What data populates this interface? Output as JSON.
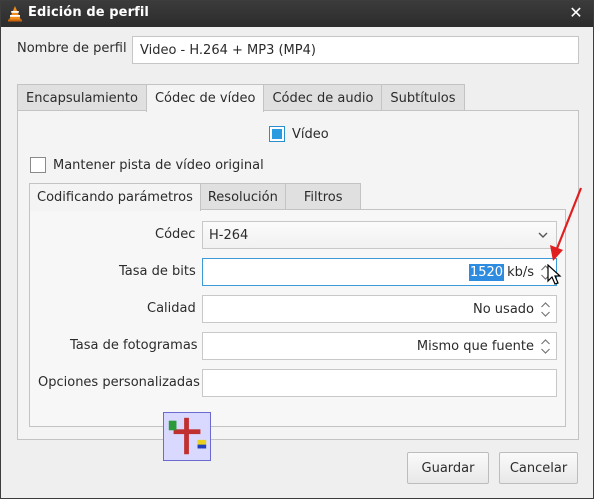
{
  "window": {
    "title": "Edición de perfil",
    "close_label": "✕"
  },
  "profile": {
    "label": "Nombre de perfil",
    "value": "Video - H.264 + MP3 (MP4)"
  },
  "tabs": [
    {
      "label": "Encapsulamiento"
    },
    {
      "label": "Códec de vídeo"
    },
    {
      "label": "Códec de audio"
    },
    {
      "label": "Subtítulos"
    }
  ],
  "video_panel": {
    "video_checkbox_label": "Vídeo",
    "keep_track_label": "Mantener pista de vídeo original",
    "inner_tabs": [
      {
        "label": "Codificando parámetros"
      },
      {
        "label": "Resolución"
      },
      {
        "label": "Filtros"
      }
    ],
    "codec": {
      "label": "Códec",
      "value": "H-264"
    },
    "bitrate": {
      "label": "Tasa de bits",
      "value": "1520",
      "unit": "kb/s"
    },
    "quality": {
      "label": "Calidad",
      "value": "No usado"
    },
    "framerate": {
      "label": "Tasa de fotogramas",
      "value": "Mismo que fuente"
    },
    "custom_options": {
      "label": "Opciones personalizadas",
      "value": ""
    }
  },
  "buttons": {
    "save": "Guardar",
    "cancel": "Cancelar"
  },
  "colors": {
    "titlebar": "#2c2c2c",
    "accent": "#2b9be0",
    "annotation": "#e02020"
  }
}
